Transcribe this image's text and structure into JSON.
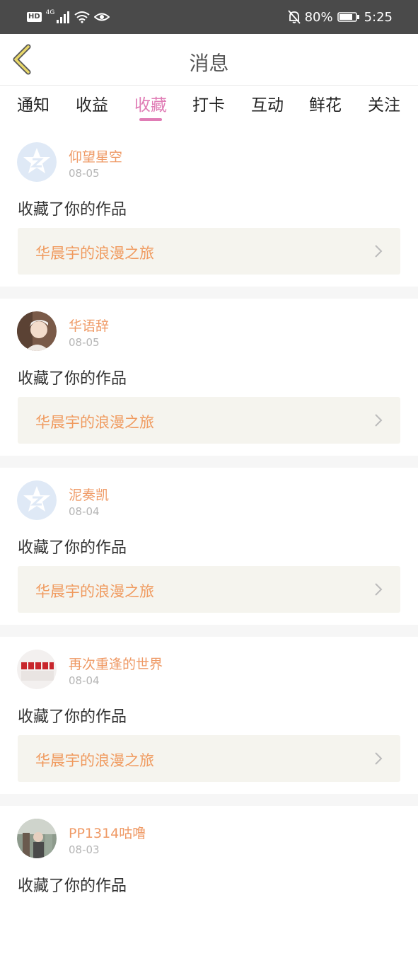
{
  "status_bar": {
    "hd": "HD",
    "network": "4G",
    "battery": "80%",
    "time": "5:25"
  },
  "header": {
    "title": "消息"
  },
  "tabs": [
    {
      "label": "通知"
    },
    {
      "label": "收益"
    },
    {
      "label": "收藏",
      "active": true
    },
    {
      "label": "打卡"
    },
    {
      "label": "互动"
    },
    {
      "label": "鲜花"
    },
    {
      "label": "关注"
    }
  ],
  "items": [
    {
      "user": "仰望星空",
      "date": "08-05",
      "action": "收藏了你的作品",
      "work": "华晨宇的浪漫之旅",
      "avatar": "default-star"
    },
    {
      "user": "华语辞",
      "date": "08-05",
      "action": "收藏了你的作品",
      "work": "华晨宇的浪漫之旅",
      "avatar": "photo-girl"
    },
    {
      "user": "泥奏凯",
      "date": "08-04",
      "action": "收藏了你的作品",
      "work": "华晨宇的浪漫之旅",
      "avatar": "default-star"
    },
    {
      "user": "再次重逢的世界",
      "date": "08-04",
      "action": "收藏了你的作品",
      "work": "华晨宇的浪漫之旅",
      "avatar": "photo-group"
    },
    {
      "user": "PP1314咕噜",
      "date": "08-03",
      "action": "收藏了你的作品",
      "work": "华晨宇的浪漫之旅",
      "avatar": "photo-street"
    }
  ],
  "colors": {
    "accent_pink": "#e07cb5",
    "username_orange": "#ef9a66",
    "work_orange": "#f09a5e",
    "work_bg": "#f5f4ee",
    "status_bar_bg": "#4a4a4a"
  }
}
